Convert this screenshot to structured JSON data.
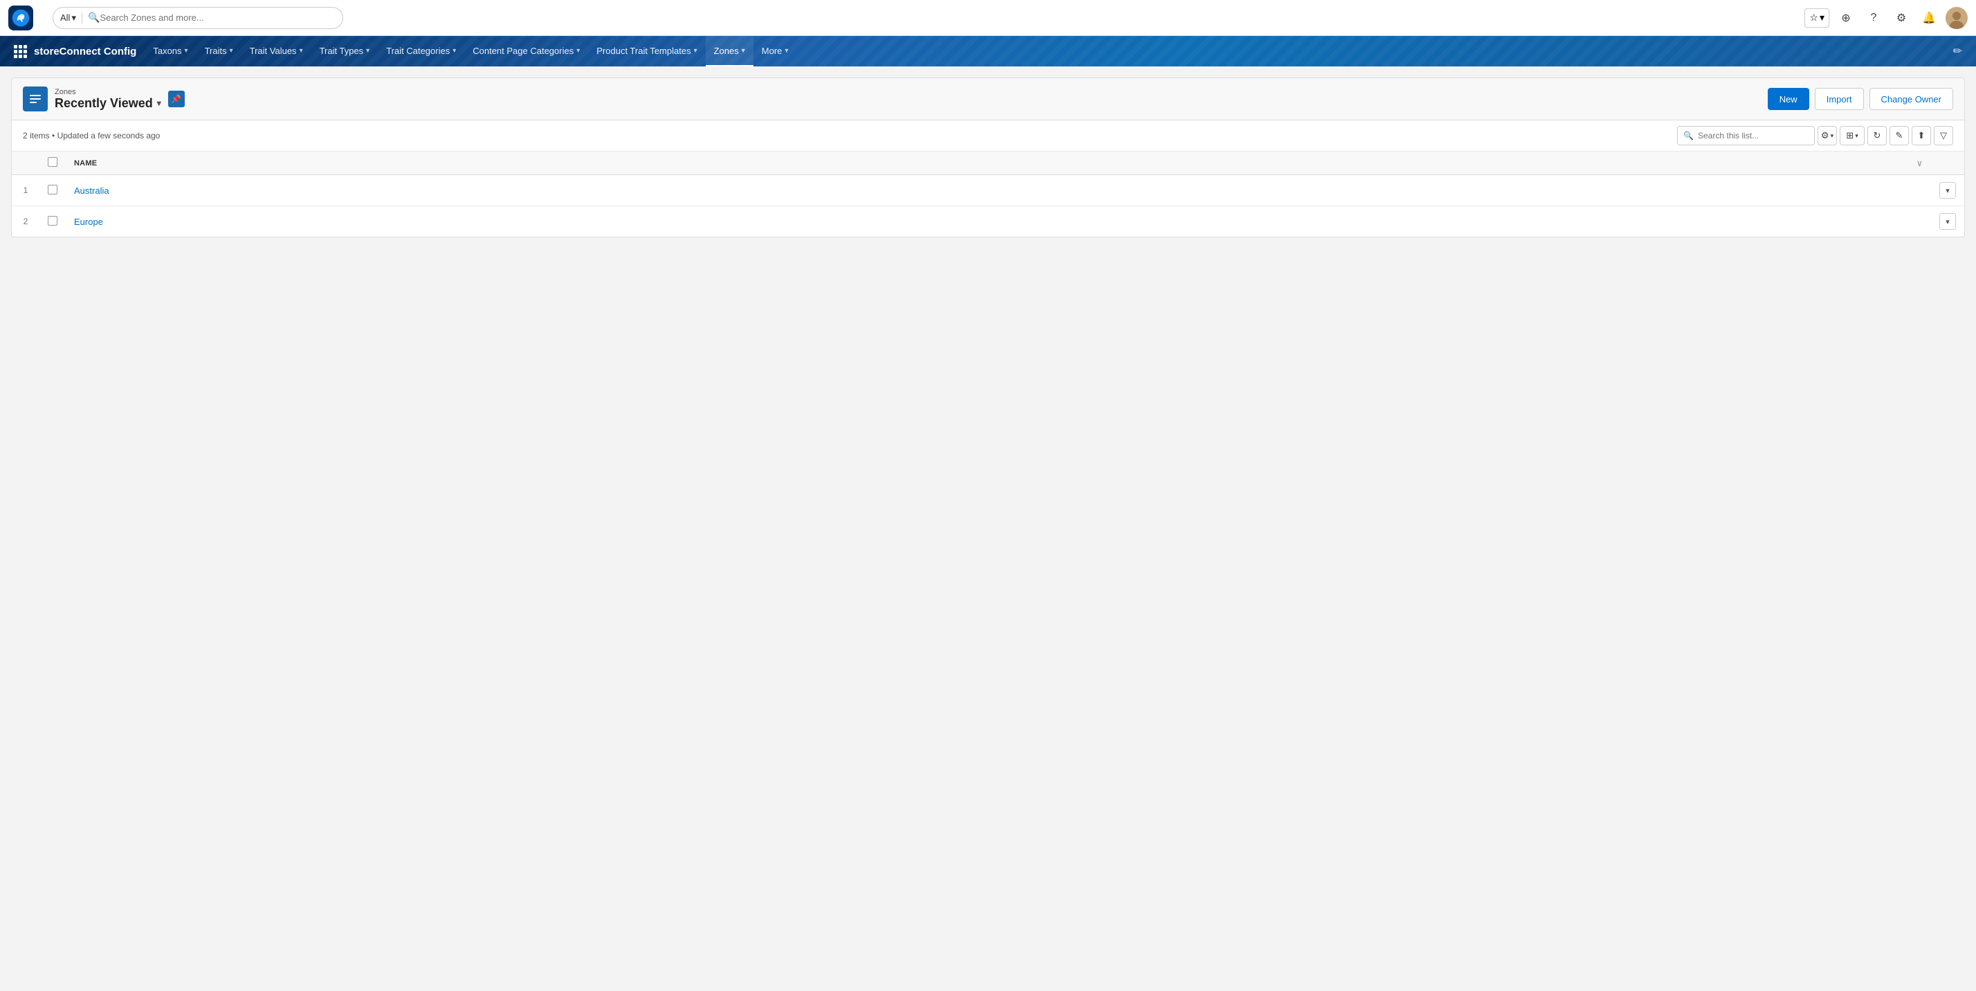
{
  "topbar": {
    "search_placeholder": "Search Zones and more...",
    "search_scope": "All",
    "logo_alt": "Salesforce logo"
  },
  "navbar": {
    "brand": "storeConnect Config",
    "items": [
      {
        "label": "Taxons",
        "has_dropdown": true,
        "active": false
      },
      {
        "label": "Traits",
        "has_dropdown": true,
        "active": false
      },
      {
        "label": "Trait Values",
        "has_dropdown": true,
        "active": false
      },
      {
        "label": "Trait Types",
        "has_dropdown": true,
        "active": false
      },
      {
        "label": "Trait Categories",
        "has_dropdown": true,
        "active": false
      },
      {
        "label": "Content Page Categories",
        "has_dropdown": true,
        "active": false
      },
      {
        "label": "Product Trait Templates",
        "has_dropdown": true,
        "active": false
      },
      {
        "label": "Zones",
        "has_dropdown": true,
        "active": true
      },
      {
        "label": "More",
        "has_dropdown": true,
        "active": false
      }
    ]
  },
  "list_view": {
    "section_label": "Zones",
    "view_name": "Recently Viewed",
    "items_count": "2 items",
    "updated_text": "Updated a few seconds ago",
    "search_placeholder": "Search this list...",
    "buttons": {
      "new": "New",
      "import": "Import",
      "change_owner": "Change Owner"
    },
    "table": {
      "columns": [
        {
          "label": "Name"
        }
      ],
      "rows": [
        {
          "num": 1,
          "name": "Australia"
        },
        {
          "num": 2,
          "name": "Europe"
        }
      ]
    }
  }
}
